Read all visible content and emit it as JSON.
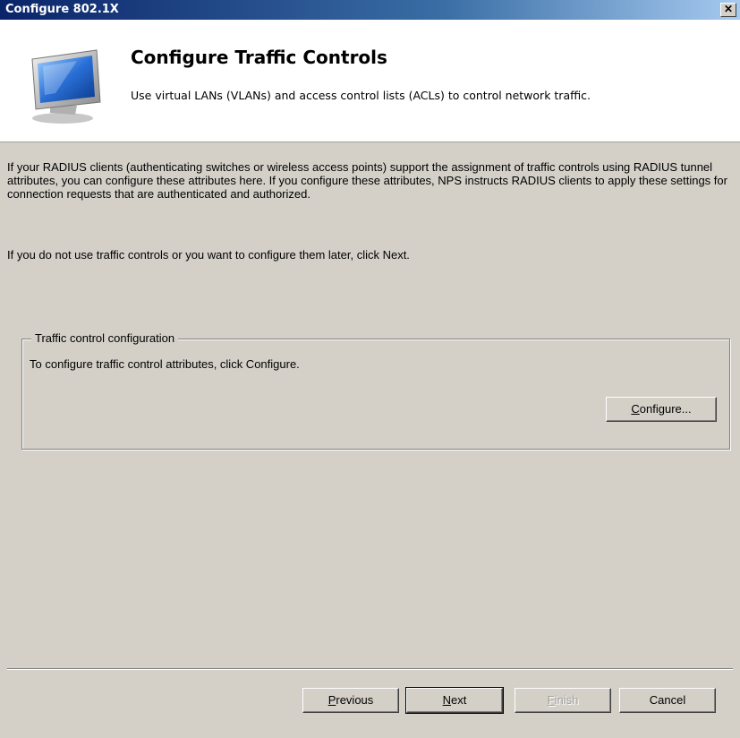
{
  "window": {
    "title": "Configure 802.1X",
    "close_label": "✕"
  },
  "header": {
    "title": "Configure Traffic Controls",
    "subtitle": "Use virtual LANs (VLANs) and access control lists (ACLs) to control network traffic.",
    "icon": "monitor-icon"
  },
  "body": {
    "intro": "If your RADIUS clients (authenticating switches or wireless access points) support the assignment of traffic controls using RADIUS tunnel attributes, you can configure these attributes here. If you configure these attributes, NPS instructs RADIUS clients to apply these settings for connection requests that are authenticated and authorized.",
    "intro2": "If you do not use traffic controls or you want to configure them later, click Next."
  },
  "group": {
    "legend": "Traffic control configuration",
    "description": "To configure traffic control attributes, click Configure.",
    "configure_button": {
      "mnemonic": "C",
      "rest": "onfigure..."
    }
  },
  "footer": {
    "previous": {
      "mnemonic": "P",
      "rest": "revious"
    },
    "next": {
      "mnemonic": "N",
      "rest": "ext"
    },
    "finish": {
      "mnemonic": "F",
      "rest": "inish",
      "enabled": false
    },
    "cancel": "Cancel"
  },
  "colors": {
    "dialog_bg": "#d4d0c8",
    "titlebar_start": "#0a246a",
    "header_bg": "#ffffff"
  }
}
